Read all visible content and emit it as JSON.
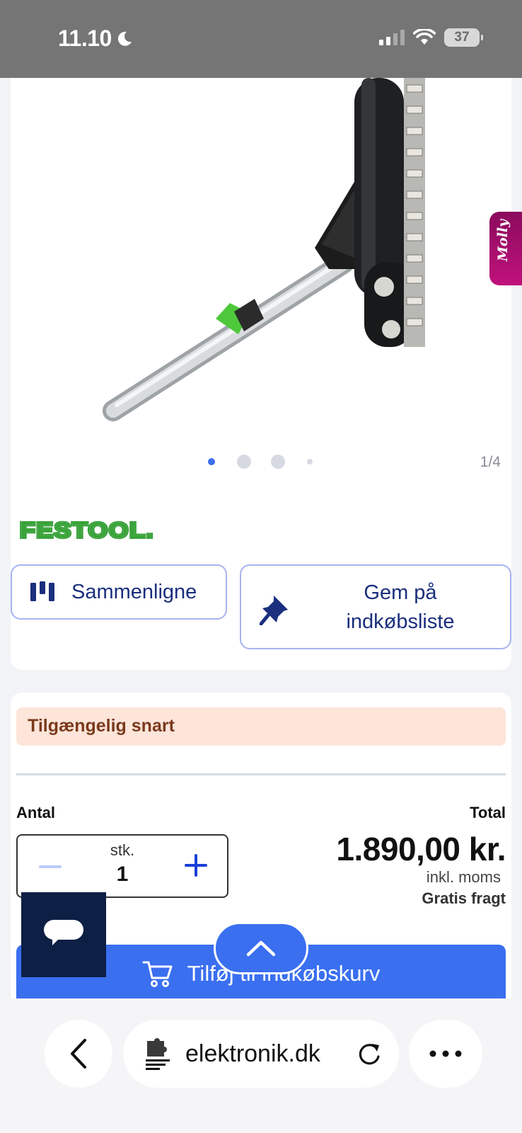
{
  "status_bar": {
    "time": "11.10",
    "battery": "37"
  },
  "product": {
    "image_counter": "1/4",
    "brand": "FESTOOL.",
    "compare_label": "Sammenligne",
    "save_label_line1": "Gem på",
    "save_label_line2": "indkøbsliste",
    "side_tab_label": "Molly"
  },
  "purchase": {
    "availability": "Tilgængelig snart",
    "quantity_label": "Antal",
    "total_label": "Total",
    "unit": "stk.",
    "quantity": "1",
    "price": "1.890,00 kr.",
    "vat_note": "inkl. moms",
    "shipping": "Gratis fragt",
    "add_to_cart": "Tilføj til indkøbskurv"
  },
  "browser": {
    "url": "elektronik.dk"
  },
  "colors": {
    "accent": "#3a6ff0",
    "brand_green": "#3aa33b",
    "navy": "#1a2f7d",
    "status_bg": "#757575"
  }
}
